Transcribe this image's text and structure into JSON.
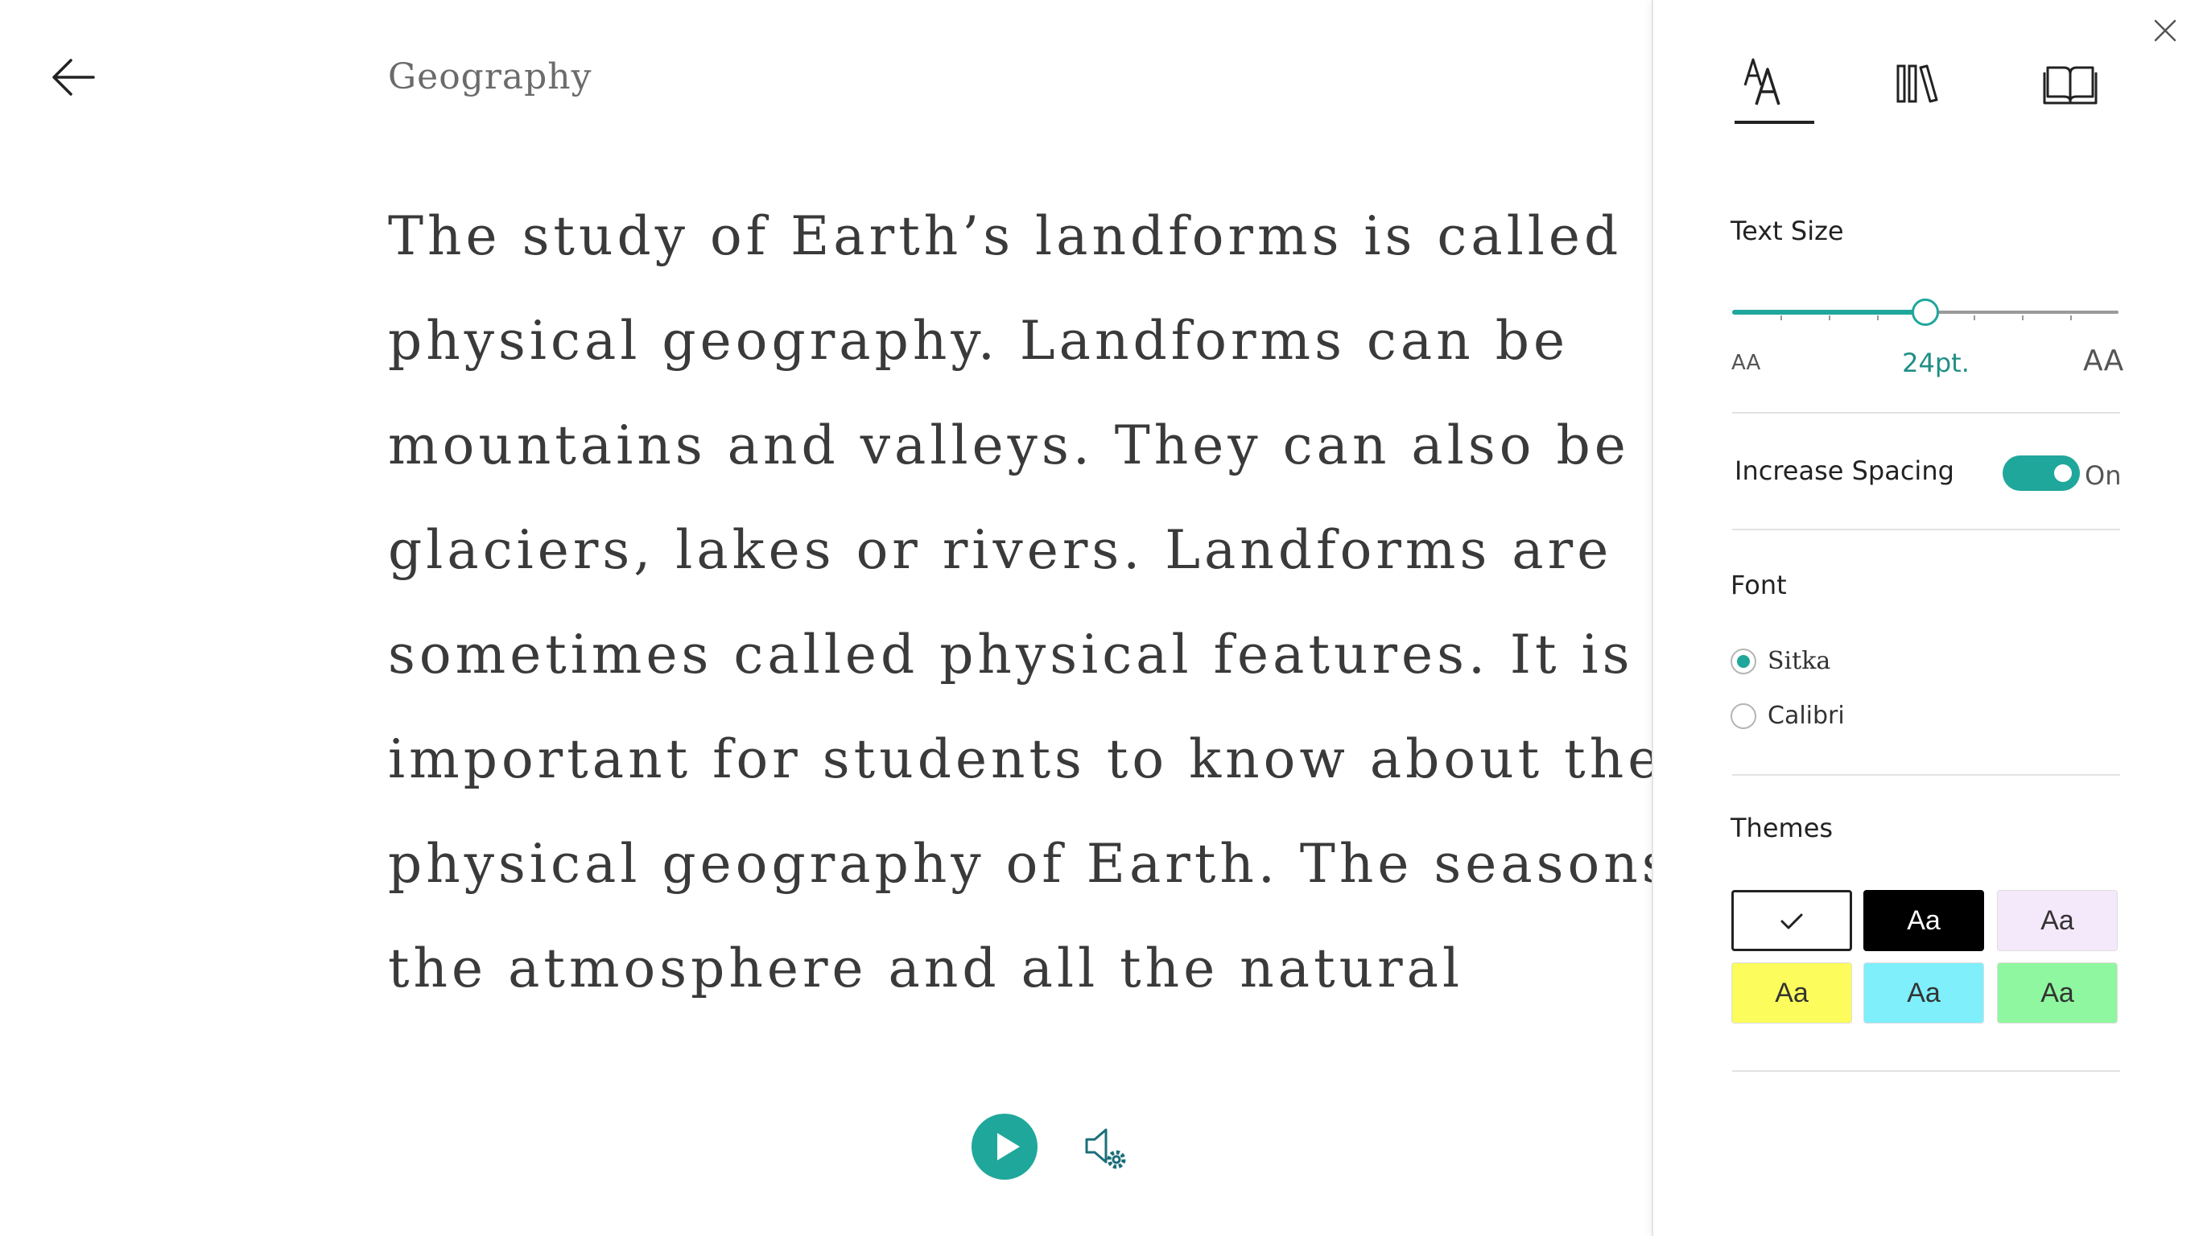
{
  "reader": {
    "title": "Geography",
    "lines": [
      "The study of Earth’s landforms is called",
      "physical geography. Landforms can be",
      "mountains and valleys. They can also be",
      "glaciers, lakes or rivers. Landforms are",
      "sometimes called physical features. It is",
      "important for students to know about the",
      "physical geography of Earth. The seasons,",
      "the atmosphere and all the natural"
    ],
    "back_icon": "arrow-left-icon",
    "play_icon": "play-icon",
    "voice_settings_icon": "speaker-gear-icon",
    "accent_color": "#1fa79b"
  },
  "panel": {
    "close_icon": "close-icon",
    "tabs": [
      {
        "icon": "text-options-icon",
        "selected": true
      },
      {
        "icon": "library-icon",
        "selected": false
      },
      {
        "icon": "book-icon",
        "selected": false
      }
    ],
    "text_size": {
      "label": "Text Size",
      "small_glyph": "AA",
      "large_glyph": "AA",
      "value": "24pt.",
      "slider_fraction": 0.5,
      "tick_count": 9
    },
    "spacing": {
      "label": "Increase Spacing",
      "state": "On",
      "enabled": true
    },
    "font": {
      "label": "Font",
      "options": [
        {
          "label": "Sitka",
          "checked": true
        },
        {
          "label": "Calibri",
          "checked": false
        }
      ]
    },
    "themes": {
      "label": "Themes",
      "items": [
        {
          "label": "",
          "selected": true,
          "bg": "#ffffff",
          "icon": "checkmark-icon"
        },
        {
          "label": "Aa",
          "selected": false,
          "bg": "#000000"
        },
        {
          "label": "Aa",
          "selected": false,
          "bg": "#f4e9fa"
        },
        {
          "label": "Aa",
          "selected": false,
          "bg": "#fcfc5c"
        },
        {
          "label": "Aa",
          "selected": false,
          "bg": "#7eeffb"
        },
        {
          "label": "Aa",
          "selected": false,
          "bg": "#8ff79f"
        }
      ]
    }
  }
}
